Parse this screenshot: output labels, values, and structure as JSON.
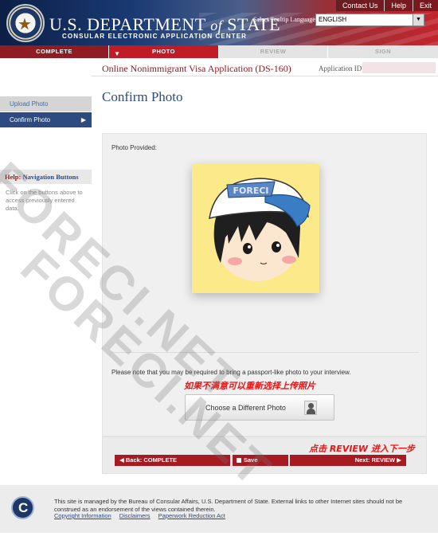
{
  "header": {
    "dept_prefix": "U.S. DEPARTMENT",
    "dept_of": "of",
    "dept_suffix": "STATE",
    "subtitle": "CONSULAR ELECTRONIC APPLICATION CENTER",
    "top_links": [
      "Contact Us",
      "Help",
      "Exit"
    ],
    "language_label": "Select Tooltip Language",
    "language_value": "ENGLISH"
  },
  "steps": [
    "COMPLETE",
    "PHOTO",
    "REVIEW",
    "SIGN"
  ],
  "application": {
    "title": "Online Nonimmigrant Visa Application (DS-160)",
    "id_label": "Application ID"
  },
  "sidebar": {
    "items": [
      "Upload Photo",
      "Confirm Photo"
    ],
    "help_prefix": "Help:",
    "help_title": "Navigation Buttons",
    "help_body": "Click on the buttons above to access previously entered data."
  },
  "main": {
    "page_title": "Confirm Photo",
    "photo_label": "Photo Provided:",
    "note": "Please note that you may be required to bring a passport-like photo to your interview.",
    "annotation_choose": "如果不满意可以重新选择上传照片",
    "choose_button": "Choose a Different Photo",
    "annotation_next": "点击 REVIEW 进入下一步"
  },
  "nav_buttons": {
    "back": "Back: COMPLETE",
    "save": "Save",
    "next": "Next: REVIEW"
  },
  "footer": {
    "logo_letter": "C",
    "text": "This site is managed by the Bureau of Consular Affairs, U.S. Department of State. External links to other Internet sites should not be construed as an endorsement of the views contained therein.",
    "links": [
      "Copyright Information",
      "Disclaimers",
      "Paperwork Reduction Act"
    ]
  },
  "watermark": "FORECI.NET",
  "colors": {
    "accent_red": "#c01c28",
    "nav_blue": "#2d4b80",
    "annotation_red": "#ee1111"
  }
}
